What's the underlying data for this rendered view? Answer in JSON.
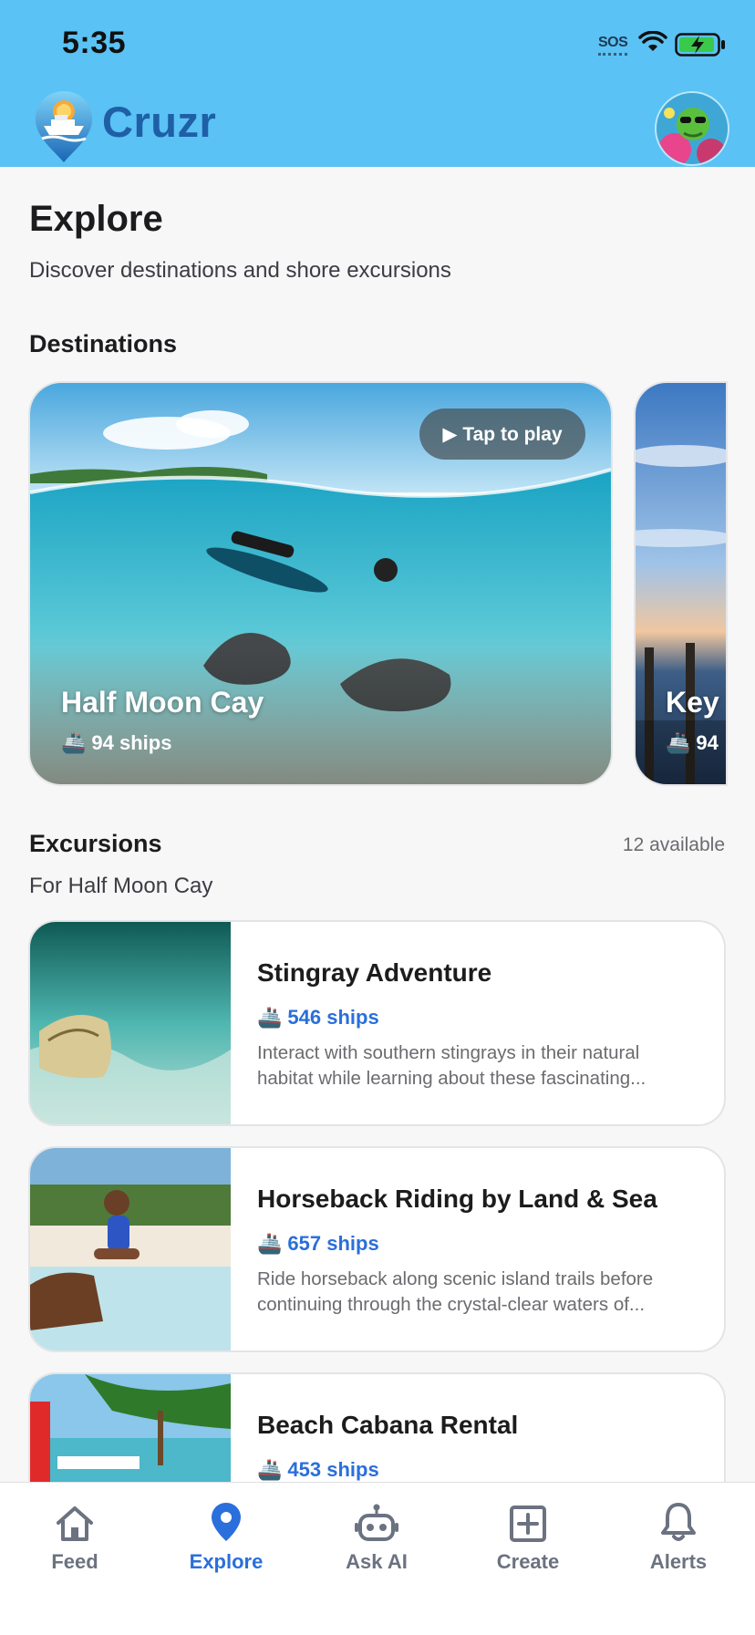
{
  "status_bar": {
    "time": "5:35",
    "sos": "SOS"
  },
  "header": {
    "brand": "Cruzr"
  },
  "page": {
    "title": "Explore",
    "subtitle": "Discover destinations and shore excursions"
  },
  "destinations": {
    "title": "Destinations",
    "play_label": "▶ Tap to play",
    "items": [
      {
        "name": "Half Moon Cay",
        "ships": "94 ships"
      },
      {
        "name": "Key",
        "ships": "94"
      }
    ]
  },
  "excursions": {
    "title": "Excursions",
    "available": "12 available",
    "for_label": "For Half Moon Cay",
    "items": [
      {
        "title": "Stingray Adventure",
        "ships": "546 ships",
        "desc_line1": "Interact with southern stingrays in their natural",
        "desc_line2": "habitat while learning about these fascinating..."
      },
      {
        "title": "Horseback Riding by Land & Sea",
        "ships": "657 ships",
        "desc_line1": "Ride horseback along scenic island trails before",
        "desc_line2": "continuing through the crystal-clear waters of..."
      },
      {
        "title": "Beach Cabana Rental",
        "ships": "453 ships",
        "desc_line1": "",
        "desc_line2": ""
      }
    ]
  },
  "tabs": [
    {
      "label": "Feed",
      "icon": "home-icon"
    },
    {
      "label": "Explore",
      "icon": "map-pin-icon",
      "active": true
    },
    {
      "label": "Ask AI",
      "icon": "robot-icon"
    },
    {
      "label": "Create",
      "icon": "plus-square-icon"
    },
    {
      "label": "Alerts",
      "icon": "bell-icon"
    }
  ],
  "colors": {
    "header_bg": "#5ac2f4",
    "brand": "#1e5fa6",
    "accent": "#2a6fdb",
    "inactive_tab": "#6b7280"
  }
}
